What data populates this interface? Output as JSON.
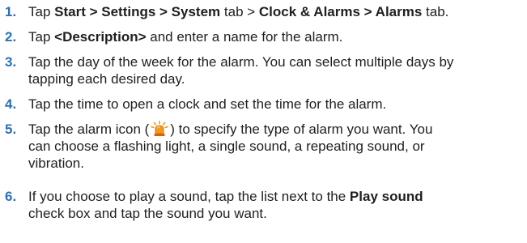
{
  "steps": [
    {
      "num": "1.",
      "segments": [
        {
          "t": "Tap ",
          "b": false
        },
        {
          "t": "Start > Settings > System",
          "b": true
        },
        {
          "t": " tab > ",
          "b": false
        },
        {
          "t": "Clock & Alarms > Alarms",
          "b": true
        },
        {
          "t": " tab.",
          "b": false
        }
      ]
    },
    {
      "num": "2.",
      "segments": [
        {
          "t": "Tap ",
          "b": false
        },
        {
          "t": "<Description>",
          "b": true
        },
        {
          "t": " and enter a name for the alarm.",
          "b": false
        }
      ]
    },
    {
      "num": "3.",
      "line1": "Tap the day of the week for the alarm. You can select multiple days by",
      "line2": "tapping each desired day."
    },
    {
      "num": "4.",
      "line1": "Tap the time to open a clock and set the time for the alarm."
    },
    {
      "num": "5.",
      "line1_pre": "Tap the alarm icon (",
      "line1_post": ") to specify the type of alarm you want. You",
      "line2": "can choose a flashing light, a single sound, a repeating sound, or",
      "line3": "vibration.",
      "icon": "alarm-light-icon"
    },
    {
      "num": "6.",
      "line1_pre": "If you choose to play a sound, tap the list next to the ",
      "line1_bold": "Play sound",
      "line2": "check box and tap the sound you want."
    }
  ],
  "colors": {
    "step_number": "#2e6fb5",
    "body_text": "#1f1f1f",
    "icon_orange": "#f39a1c",
    "icon_dark_orange": "#d8600c"
  }
}
